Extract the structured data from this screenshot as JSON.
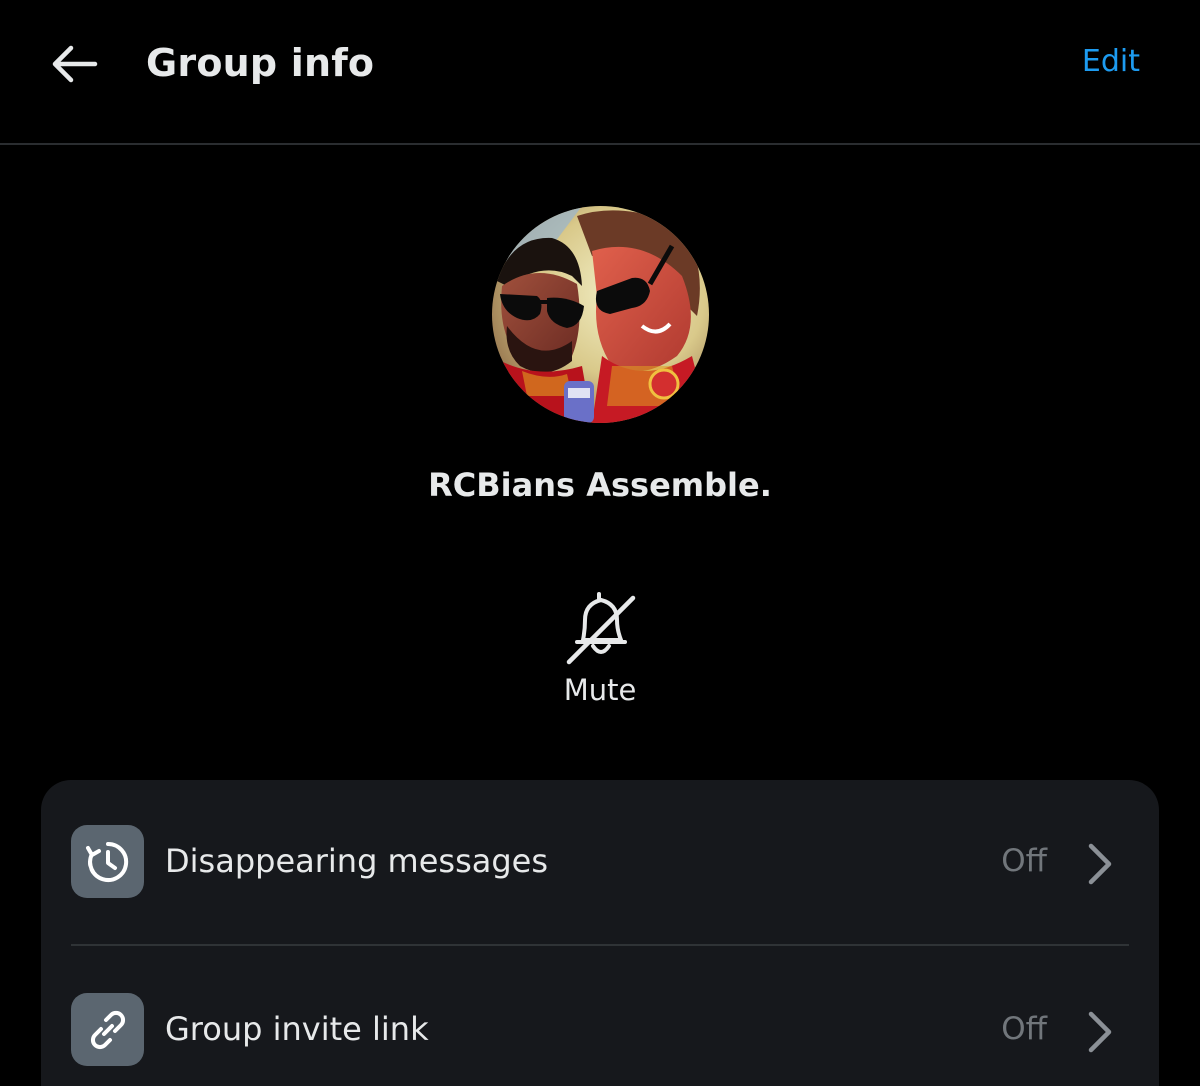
{
  "header": {
    "title": "Group info",
    "edit_label": "Edit",
    "back_icon": "arrow-left-icon"
  },
  "group": {
    "name": "RCBians Assemble.",
    "avatar": "group-avatar-photo"
  },
  "actions": {
    "mute_label": "Mute",
    "mute_icon": "bell-off-icon"
  },
  "settings": [
    {
      "label": "Disappearing messages",
      "value": "Off",
      "icon": "timer-history-icon"
    },
    {
      "label": "Group invite link",
      "value": "Off",
      "icon": "link-icon"
    }
  ],
  "colors": {
    "background": "#000000",
    "accent": "#1d9bf0",
    "card": "#16181c",
    "icon_tile": "#5b6670",
    "muted_text": "#71767b"
  }
}
